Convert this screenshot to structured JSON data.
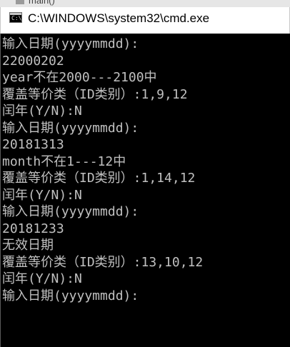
{
  "background_window": {
    "tab_label": "main()"
  },
  "window": {
    "title": "C:\\WINDOWS\\system32\\cmd.exe",
    "icon": "cmd-console-icon"
  },
  "console": {
    "text_color": "#c0c0c0",
    "background_color": "#000000",
    "lines": [
      "输入日期(yyyymmdd):",
      "22000202",
      "year不在2000---2100中",
      "覆盖等价类（ID类别）:1,9,12",
      "闰年(Y/N):N",
      "输入日期(yyyymmdd):",
      "20181313",
      "month不在1---12中",
      "覆盖等价类（ID类别）:1,14,12",
      "闰年(Y/N):N",
      "输入日期(yyyymmdd):",
      "20181233",
      "无效日期",
      "覆盖等价类（ID类别）:13,10,12",
      "闰年(Y/N):N",
      "输入日期(yyyymmdd):"
    ]
  }
}
